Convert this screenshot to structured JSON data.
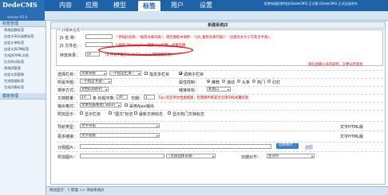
{
  "app": {
    "logo_text": "DedeCMS",
    "version": "version V5.0",
    "notice": "织梦快速织梦科技(DedeCMS) 正式版 (DedeCMS) 正式达成合作"
  },
  "nav": {
    "tabs": [
      "内容",
      "应用",
      "模型",
      "标签",
      "用户",
      "设置"
    ],
    "active": "标签"
  },
  "sidebar": {
    "head": "标签管理",
    "items": [
      "系统函数标签",
      "自定义SQL函数标签",
      "自定义单标签",
      "自定义JSON标签",
      "生成JS/XML文档",
      "分页样式标签",
      "系统JS管理",
      "自定义JS管理",
      "生成频道标签",
      "生成列表标签"
    ],
    "footer_head": "模板管理"
  },
  "form": {
    "title": "新建系统JS",
    "fieldset_legend": "JS基本信息",
    "name_label": "JS 名 称：",
    "name_value": "",
    "name_note": "* 例如JS名称：\"推荐文章列表\"，则在模板中调用：\"{JS_推荐文章列表}\"（注意名文大小写及全半角）。",
    "file_label": "JS 文件名：",
    "file_value": "",
    "file_note": "* 例如 \"News.js\" 一定要以.js结尾，如果后缀",
    "path_label": "存放目录：",
    "path_value": "/js",
    "path_hint": "（文件名不能有\"/ \\ * ? \" < > | \"等特殊符号）",
    "path_note": "请在此输入JS的说明，方便以后查找",
    "col_label": "选择栏目：",
    "col_select": "文章系统",
    "col_select2": "--不指定栏目--",
    "chk_specify": "指定多栏目",
    "chk_sub": "调用子栏目",
    "flag_label": "所属专题：",
    "flag_select": "--不指定专题--",
    "attr_label": "属性控制：",
    "attr_options": [
      "推荐",
      "滚动",
      "头条",
      "热门",
      "幻灯"
    ],
    "sort_label": "排序方式：",
    "sort_select": "文档ID(降序)",
    "link_label": "链接目标：",
    "link_select": "新窗口",
    "count_label": "文档数量：",
    "count_value": "10",
    "count_mid": "条 标题字数：",
    "title_len": "30",
    "date_label": "日期：",
    "date_value": "1",
    "date_note": "Tips:若启用文档类缩图，但需要判断是否启用的样式量控制",
    "output_label": "输出格式：",
    "output_select": "文本列表样式(Table)",
    "chk_ajax": "采用Ajax输出",
    "misc_label": "附加显示：",
    "misc_options": [
      "显示栏目",
      "\"图文\"标志",
      "最新文档标志",
      "显示热门文档标志"
    ],
    "nav_label": "导航类型：",
    "nav_select": "文字导航",
    "nav_right": "文字HTML版",
    "more_label": "更多链接：",
    "more_select": "文字链接",
    "more_right": "文字HTML版",
    "pic_label": "分隔图片：",
    "pic_btn": "选择图片...",
    "pic_reset": "还原",
    "extra_label": "附加图片：",
    "extra_select": "--无请选择日期--",
    "align_label": "日期对齐：",
    "align_select": "左对齐"
  },
  "footer": {
    "path": "附加显示：1 管理 >> 添加系统JS"
  }
}
